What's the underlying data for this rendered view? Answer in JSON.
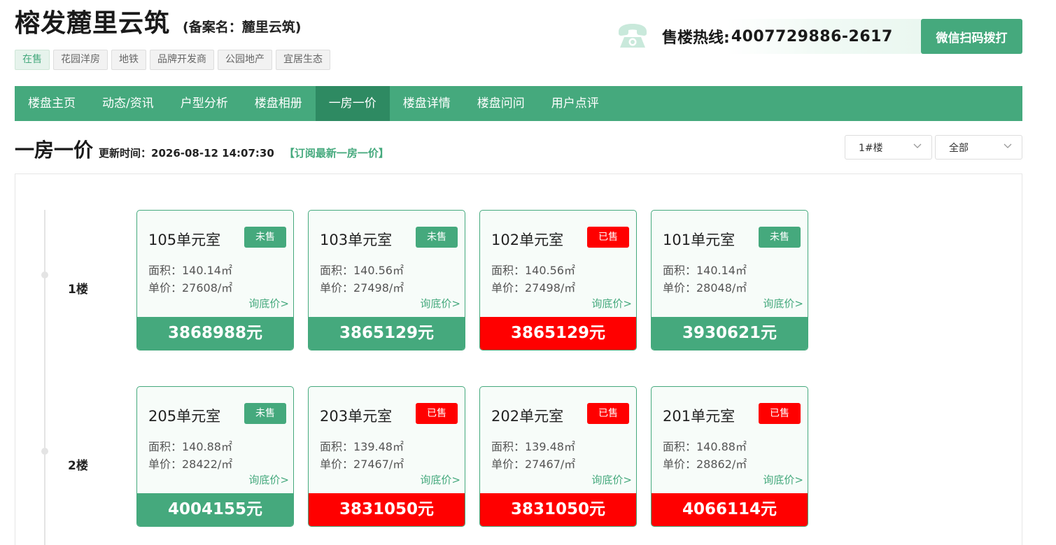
{
  "header": {
    "title": "榕发麓里云筑",
    "record_name": "(备案名：麓里云筑)",
    "tags": [
      {
        "label": "在售",
        "highlight": true
      },
      {
        "label": "花园洋房",
        "highlight": false
      },
      {
        "label": "地铁",
        "highlight": false
      },
      {
        "label": "品牌开发商",
        "highlight": false
      },
      {
        "label": "公园地产",
        "highlight": false
      },
      {
        "label": "宜居生态",
        "highlight": false
      }
    ],
    "hotline_label": "售楼热线:",
    "hotline_number": "4007729886-2617",
    "wechat_button": "微信扫码拨打"
  },
  "nav": [
    {
      "label": "楼盘主页",
      "active": false
    },
    {
      "label": "动态/资讯",
      "active": false
    },
    {
      "label": "户型分析",
      "active": false
    },
    {
      "label": "楼盘相册",
      "active": false
    },
    {
      "label": "一房一价",
      "active": true
    },
    {
      "label": "楼盘详情",
      "active": false
    },
    {
      "label": "楼盘问问",
      "active": false
    },
    {
      "label": "用户点评",
      "active": false
    }
  ],
  "section": {
    "title": "一房一价",
    "update_time": "更新时间：2026-08-12 14:07:30",
    "subscribe": "【订阅最新一房一价】",
    "building_select": "1#楼",
    "status_select": "全部"
  },
  "colors": {
    "brand_green": "#45a97d",
    "nav_active": "#2e8a62",
    "sold_red": "#ff0000"
  },
  "labels": {
    "unsold": "未售",
    "sold": "已售",
    "ask_price": "询底价>"
  },
  "floors": [
    {
      "label": "1楼",
      "units": [
        {
          "name": "105单元室",
          "status": "未售",
          "sold": false,
          "area": "面积：140.14㎡",
          "unit_price": "单价：27608/㎡",
          "total": "3868988元"
        },
        {
          "name": "103单元室",
          "status": "未售",
          "sold": false,
          "area": "面积：140.56㎡",
          "unit_price": "单价：27498/㎡",
          "total": "3865129元"
        },
        {
          "name": "102单元室",
          "status": "已售",
          "sold": true,
          "area": "面积：140.56㎡",
          "unit_price": "单价：27498/㎡",
          "total": "3865129元"
        },
        {
          "name": "101单元室",
          "status": "未售",
          "sold": false,
          "area": "面积：140.14㎡",
          "unit_price": "单价：28048/㎡",
          "total": "3930621元"
        }
      ]
    },
    {
      "label": "2楼",
      "units": [
        {
          "name": "205单元室",
          "status": "未售",
          "sold": false,
          "area": "面积：140.88㎡",
          "unit_price": "单价：28422/㎡",
          "total": "4004155元"
        },
        {
          "name": "203单元室",
          "status": "已售",
          "sold": true,
          "area": "面积：139.48㎡",
          "unit_price": "单价：27467/㎡",
          "total": "3831050元"
        },
        {
          "name": "202单元室",
          "status": "已售",
          "sold": true,
          "area": "面积：139.48㎡",
          "unit_price": "单价：27467/㎡",
          "total": "3831050元"
        },
        {
          "name": "201单元室",
          "status": "已售",
          "sold": true,
          "area": "面积：140.88㎡",
          "unit_price": "单价：28862/㎡",
          "total": "4066114元"
        }
      ]
    }
  ]
}
